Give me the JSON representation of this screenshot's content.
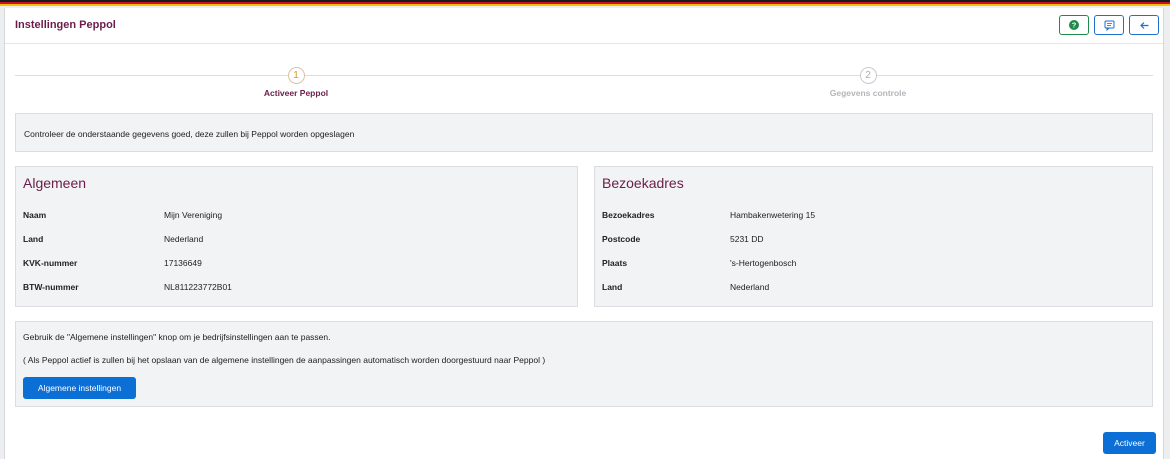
{
  "colors": {
    "flag_stripes": [
      "#1a1a1a",
      "#c8102e",
      "#f2c200"
    ],
    "title_accent": "#6b1d4a",
    "primary": "#0b6fd6",
    "step_active_number": "#e0952b"
  },
  "header": {
    "title": "Instellingen Peppol",
    "buttons": [
      {
        "icon": "help-circle-icon"
      },
      {
        "icon": "chat-icon"
      },
      {
        "icon": "arrow-left-icon"
      }
    ]
  },
  "stepper": {
    "steps": [
      {
        "number": "1",
        "label": "Activeer Peppol",
        "state": "active"
      },
      {
        "number": "2",
        "label": "Gegevens controle",
        "state": "inactive"
      }
    ]
  },
  "info": {
    "text": "Controleer de onderstaande gegevens goed, deze zullen bij Peppol worden opgeslagen"
  },
  "algemeen": {
    "title": "Algemeen",
    "rows": [
      {
        "label": "Naam",
        "value": "Mijn Vereniging"
      },
      {
        "label": "Land",
        "value": "Nederland"
      },
      {
        "label": "KVK-nummer",
        "value": "17136649"
      },
      {
        "label": "BTW-nummer",
        "value": "NL811223772B01"
      }
    ]
  },
  "bezoekadres": {
    "title": "Bezoekadres",
    "rows": [
      {
        "label": "Bezoekadres",
        "value": "Hambakenwetering 15"
      },
      {
        "label": "Postcode",
        "value": "5231 DD"
      },
      {
        "label": "Plaats",
        "value": "'s-Hertogenbosch"
      },
      {
        "label": "Land",
        "value": "Nederland"
      }
    ]
  },
  "note": {
    "line1": "Gebruik de \"Algemene instellingen\" knop om je bedrijfsinstellingen aan te passen.",
    "line2": "( Als Peppol actief is zullen bij het opslaan van de algemene instellingen de aanpassingen automatisch worden doorgestuurd naar Peppol )",
    "button_label": "Algemene instellingen"
  },
  "footer": {
    "activate_label": "Activeer"
  }
}
